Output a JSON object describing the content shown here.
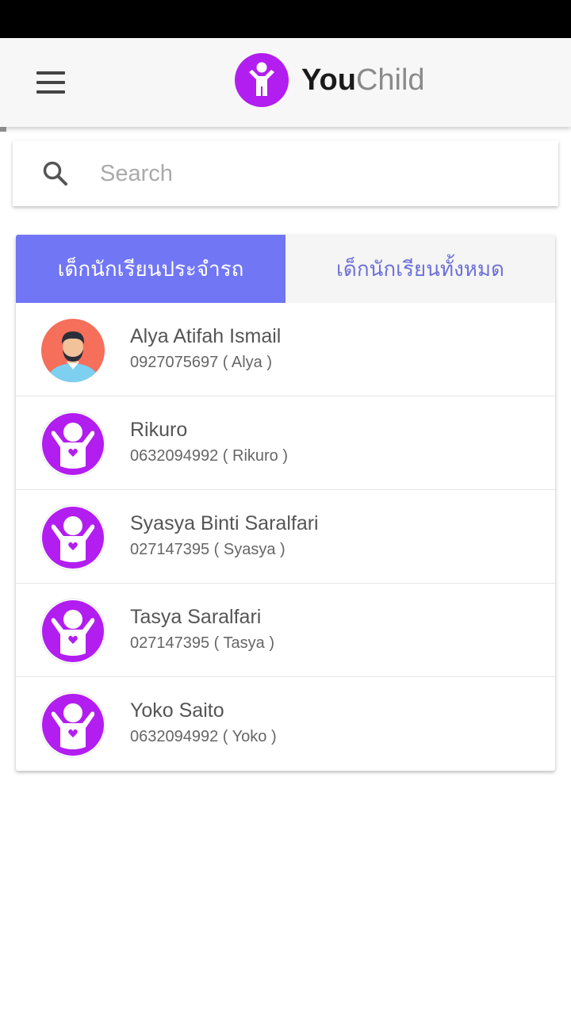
{
  "app": {
    "logo_you": "You",
    "logo_child": "Child",
    "brand_color": "#b21ef0",
    "accent_color": "#7176f5"
  },
  "search": {
    "placeholder": "Search"
  },
  "tabs": [
    {
      "label": "เด็กนักเรียนประจำรถ",
      "active": true
    },
    {
      "label": "เด็กนักเรียนทั้งหมด",
      "active": false
    }
  ],
  "students": [
    {
      "name": "Alya Atifah Ismail",
      "detail": "0927075697 ( Alya )",
      "avatar": "man-avatar-icon"
    },
    {
      "name": "Rikuro",
      "detail": "0632094992 ( Rikuro )",
      "avatar": "child-avatar-icon"
    },
    {
      "name": "Syasya Binti Saralfari",
      "detail": "027147395 ( Syasya )",
      "avatar": "child-avatar-icon"
    },
    {
      "name": "Tasya Saralfari",
      "detail": "027147395 ( Tasya )",
      "avatar": "child-avatar-icon"
    },
    {
      "name": "Yoko Saito",
      "detail": "0632094992 ( Yoko )",
      "avatar": "child-avatar-icon"
    }
  ]
}
